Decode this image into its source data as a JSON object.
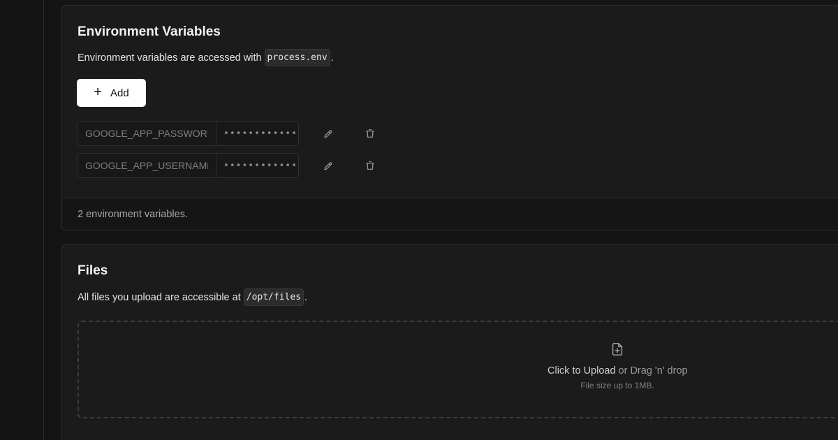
{
  "env_section": {
    "title": "Environment Variables",
    "desc_prefix": "Environment variables are accessed with",
    "desc_code": "process.env",
    "desc_suffix": ".",
    "add_button_label": "Add",
    "add_button_icon": "plus-icon",
    "rows": [
      {
        "key": "GOOGLE_APP_PASSWORD",
        "value": "••••••••••••••••",
        "edit_icon": "pencil-icon",
        "delete_icon": "trash-icon"
      },
      {
        "key": "GOOGLE_APP_USERNAME",
        "value": "••••••••••••••••",
        "edit_icon": "pencil-icon",
        "delete_icon": "trash-icon"
      }
    ],
    "footer_text": "2 environment variables."
  },
  "files_section": {
    "title": "Files",
    "desc_prefix": "All files you upload are accessible at",
    "desc_code": "/opt/files",
    "desc_suffix": ".",
    "dropzone": {
      "icon": "file-plus-icon",
      "primary": "Click to Upload",
      "secondary": " or Drag 'n' drop",
      "hint": "File size up to 1MB."
    }
  }
}
